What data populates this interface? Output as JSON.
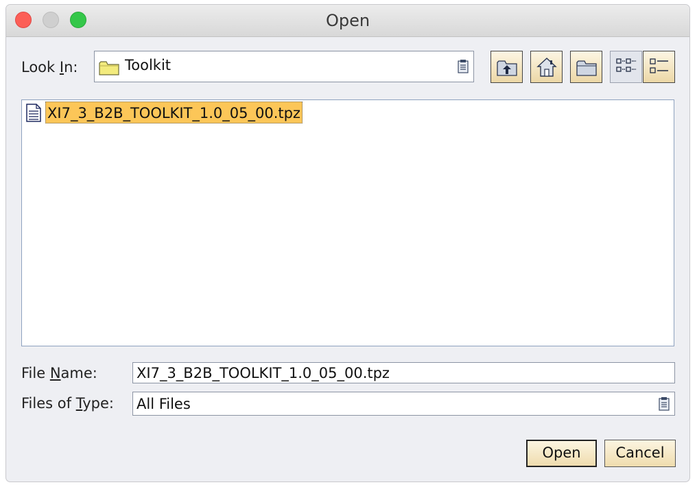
{
  "window": {
    "title": "Open"
  },
  "lookin": {
    "label_pre": "Look ",
    "label_key": "I",
    "label_post": "n:",
    "value": "Toolkit",
    "icon": "folder-icon"
  },
  "toolbar": [
    {
      "name": "up-one-level-button",
      "icon": "folder-up-icon"
    },
    {
      "name": "home-button",
      "icon": "home-icon"
    },
    {
      "name": "new-folder-button",
      "icon": "new-folder-icon"
    },
    {
      "name": "list-view-button",
      "icon": "list-view-icon",
      "pressed": true
    },
    {
      "name": "details-view-button",
      "icon": "details-view-icon"
    }
  ],
  "files": [
    {
      "name": "XI7_3_B2B_TOOLKIT_1.0_05_00.tpz",
      "icon": "file-icon",
      "selected": true
    }
  ],
  "filename": {
    "label_pre": "File ",
    "label_key": "N",
    "label_post": "ame:",
    "value": "XI7_3_B2B_TOOLKIT_1.0_05_00.tpz"
  },
  "filetype": {
    "label_pre": "Files of ",
    "label_key": "T",
    "label_post": "ype:",
    "value": "All Files"
  },
  "buttons": {
    "open": "Open",
    "cancel": "Cancel"
  },
  "colors": {
    "selection": "#fcc658",
    "button_face": "#efdcae",
    "dialog_bg": "#eeeff3"
  }
}
